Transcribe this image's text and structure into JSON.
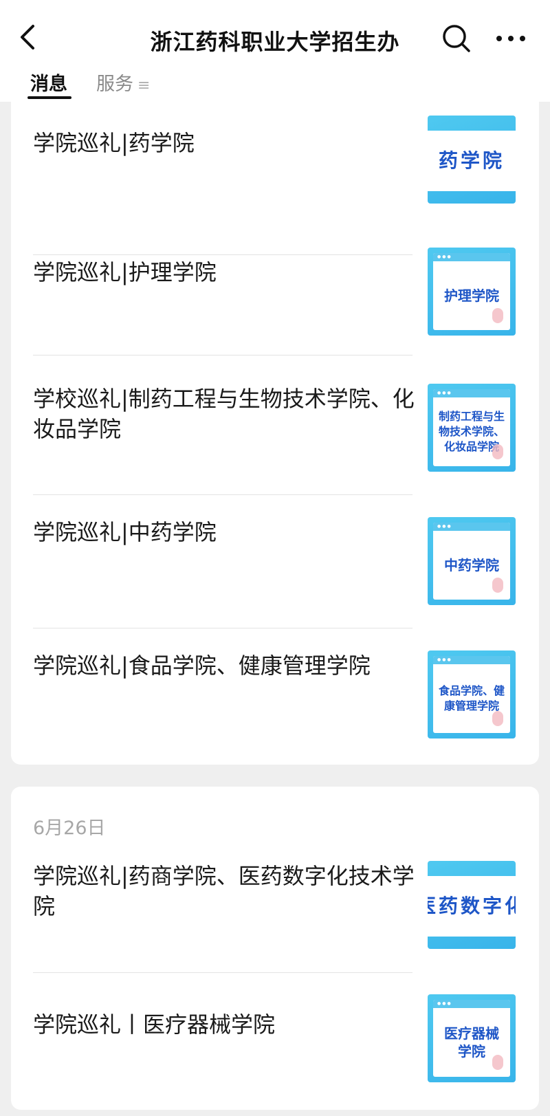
{
  "header": {
    "title": "浙江药科职业大学招生办",
    "back_icon": "chevron-left-icon",
    "search_icon": "search-icon",
    "more_icon": "more-horizontal-icon"
  },
  "tabs": [
    {
      "label": "消息",
      "active": true
    },
    {
      "label": "服务",
      "active": false,
      "glyph": "≡"
    }
  ],
  "section1": {
    "items": [
      {
        "title": "学院巡礼|药学院",
        "thumb_text": "药学院"
      },
      {
        "title": "学院巡礼|护理学院",
        "thumb_text": "护理学院"
      },
      {
        "title": "学校巡礼|制药工程与生物技术学院、化妆品学院",
        "thumb_text": "制药工程与生物技术学院、化妆品学院"
      },
      {
        "title": "学院巡礼|中药学院",
        "thumb_text": "中药学院"
      },
      {
        "title": "学院巡礼|食品学院、健康管理学院",
        "thumb_text": "食品学院、健康管理学院"
      }
    ]
  },
  "section2": {
    "date": "6月26日",
    "items": [
      {
        "title": "学院巡礼|药商学院、医药数字化技术学院",
        "thumb_text": "、医药数字化技"
      },
      {
        "title": "学院巡礼丨医疗器械学院",
        "thumb_text": "医疗器械学院"
      }
    ]
  },
  "colors": {
    "thumb_bg": "#38b4ea",
    "thumb_text": "#1e56c7",
    "page_bg": "#efefef"
  }
}
